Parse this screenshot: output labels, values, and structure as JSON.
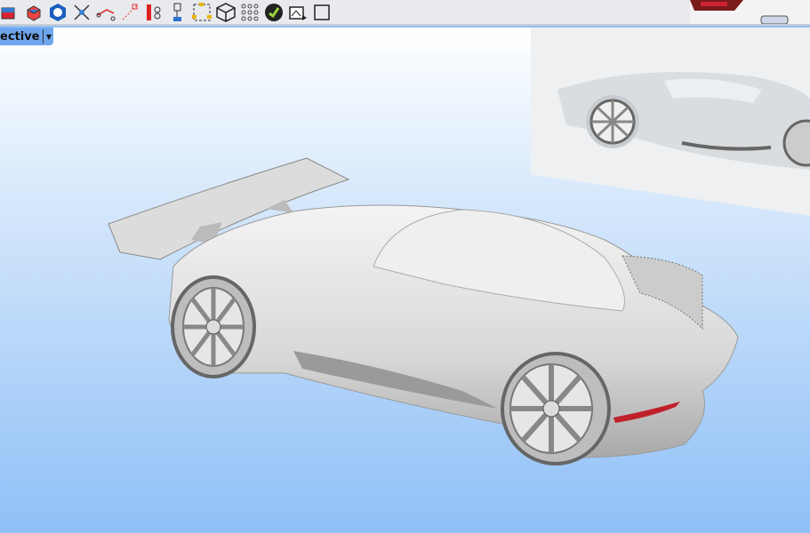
{
  "toolbar": {
    "icons": [
      "solid-box-icon",
      "solid-tools-icon",
      "polygon-ring-icon",
      "transform-icon",
      "curve-edit-icon",
      "point-edit-icon",
      "control-points-icon",
      "gumball-icon",
      "group-icon",
      "box-wire-icon",
      "point-grid-icon",
      "check-icon",
      "render-image-icon",
      "frame-icon"
    ]
  },
  "viewport": {
    "name": "ective",
    "dropdown_icon": "triangle-down-icon"
  },
  "colors": {
    "tab": "#6ea6ee",
    "viewport_bottom": "#8fc0f7",
    "taillight": "#c0202a"
  }
}
